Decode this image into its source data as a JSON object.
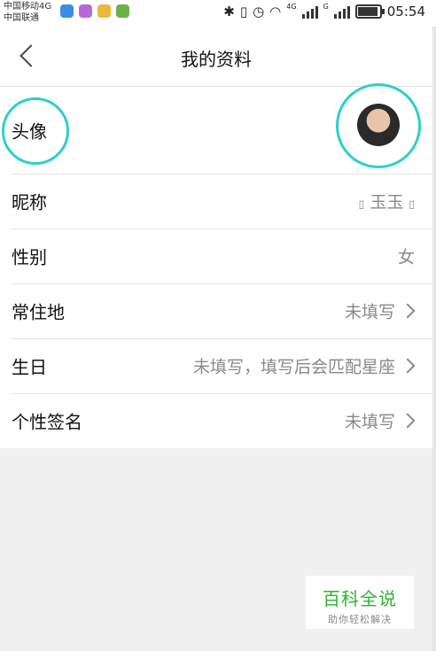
{
  "status_bar": {
    "carrier_1": "中国移动4G",
    "carrier_2": "中国联通",
    "network_1": "4G",
    "network_2": "G",
    "time": "05:54",
    "battery_level": 0.85
  },
  "header": {
    "title": "我的资料"
  },
  "profile": {
    "rows": [
      {
        "label": "头像"
      },
      {
        "label": "昵称",
        "value": "玉玉"
      },
      {
        "label": "性别",
        "value": "女"
      },
      {
        "label": "常住地",
        "value": "未填写"
      },
      {
        "label": "生日",
        "value": "未填写，填写后会匹配星座"
      },
      {
        "label": "个性签名",
        "value": "未填写"
      }
    ]
  },
  "watermark": {
    "title": "百科全说",
    "subtitle": "助你轻松解决"
  },
  "colors": {
    "highlight_circle": "#2ccfcf",
    "watermark_green": "#2db52d"
  }
}
